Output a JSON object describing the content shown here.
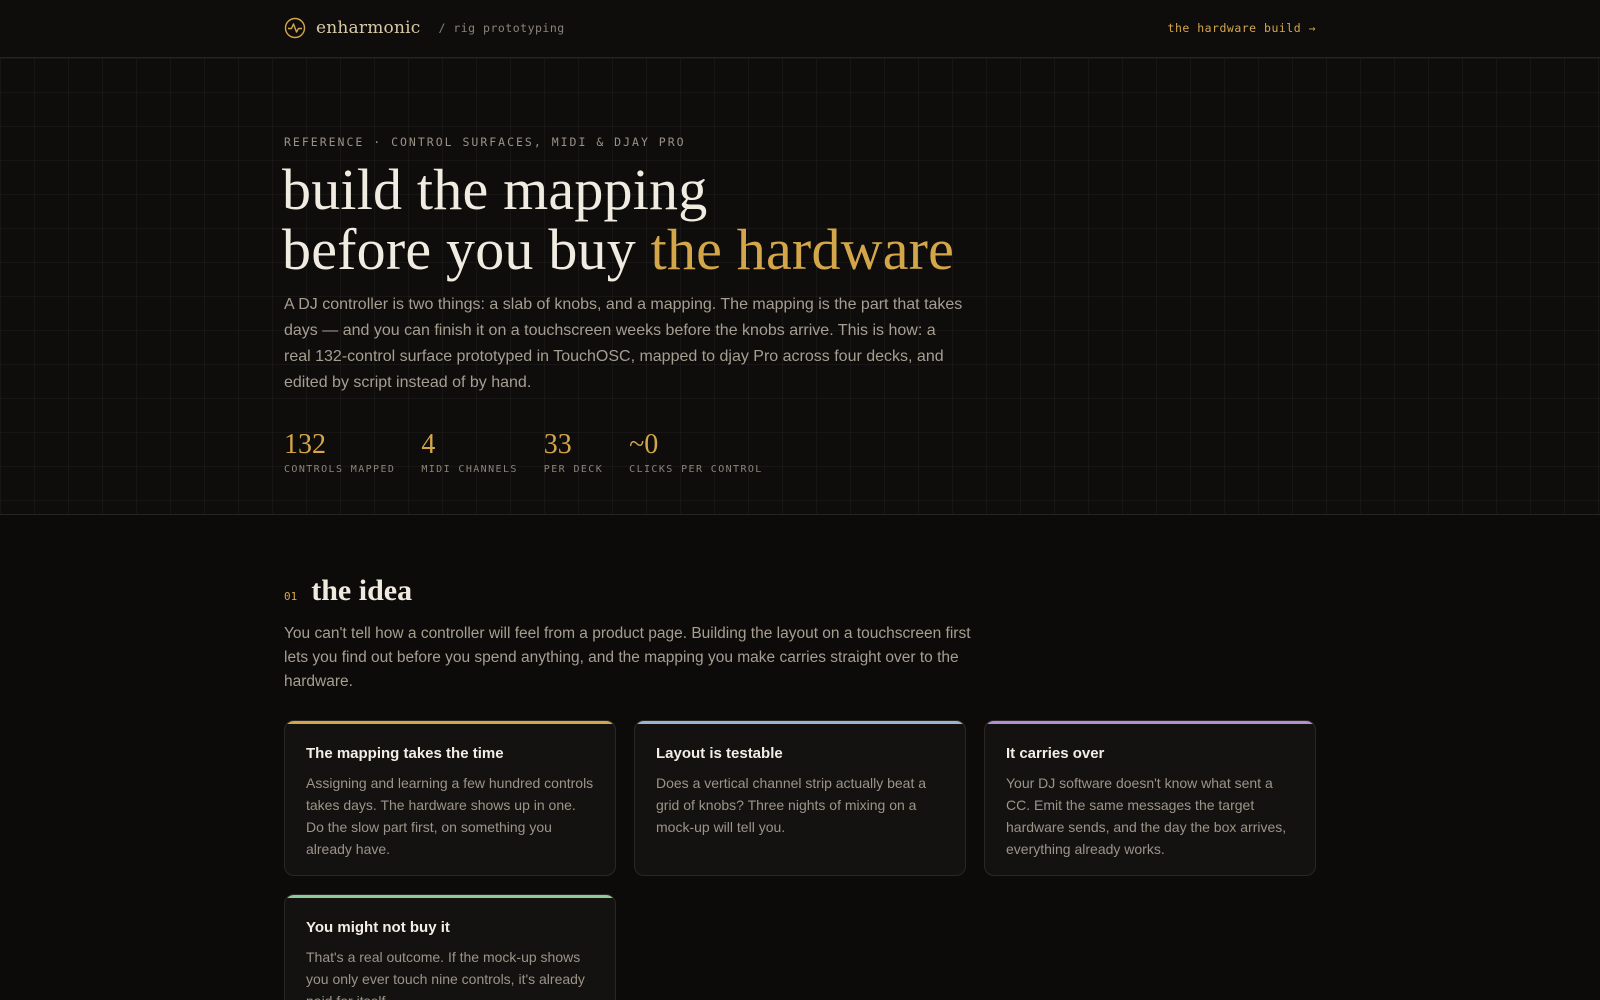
{
  "topbar": {
    "brand_name": "enharmonic",
    "breadcrumb": "/ rig prototyping",
    "link": "the hardware build →"
  },
  "hero": {
    "eyebrow": "REFERENCE · CONTROL SURFACES, MIDI & DJAY PRO",
    "headline_line1": "build the mapping",
    "headline_line2_plain": "before you buy",
    "headline_line2_accent": "the hardware",
    "lede": "A DJ controller is two things: a slab of knobs, and a mapping. The mapping is the part that takes days — and you can finish it on a touchscreen weeks before the knobs arrive. This is how: a real 132-control surface prototyped in TouchOSC, mapped to djay Pro across four decks, and edited by script instead of by hand.",
    "stats": [
      {
        "value": "132",
        "label": "CONTROLS MAPPED"
      },
      {
        "value": "4",
        "label": "MIDI CHANNELS"
      },
      {
        "value": "33",
        "label": "PER DECK"
      },
      {
        "value": "~0",
        "label": "CLICKS PER CONTROL"
      }
    ]
  },
  "section": {
    "number": "01",
    "title": "the idea",
    "lede": "You can't tell how a controller will feel from a product page. Building the layout on a touchscreen first lets you find out before you spend anything, and the mapping you make carries straight over to the hardware."
  },
  "cards": [
    {
      "title": "The mapping takes the time",
      "body": "Assigning and learning a few hundred controls takes days. The hardware shows up in one. Do the slow part first, on something you already have.",
      "accent": "#d4a64a"
    },
    {
      "title": "Layout is testable",
      "body": "Does a vertical channel strip actually beat a grid of knobs? Three nights of mixing on a mock-up will tell you.",
      "accent": "#9bb4cf"
    },
    {
      "title": "It carries over",
      "body": "Your DJ software doesn't know what sent a CC. Emit the same messages the target hardware sends, and the day the box arrives, everything already works.",
      "accent": "#b78ed1"
    },
    {
      "title": "You might not buy it",
      "body": "That's a real outcome. If the mock-up shows you only ever touch nine controls, it's already paid for itself.",
      "accent": "#8ec99a"
    }
  ],
  "colors": {
    "background": "#0c0b0a",
    "accent": "#d4a64a"
  }
}
